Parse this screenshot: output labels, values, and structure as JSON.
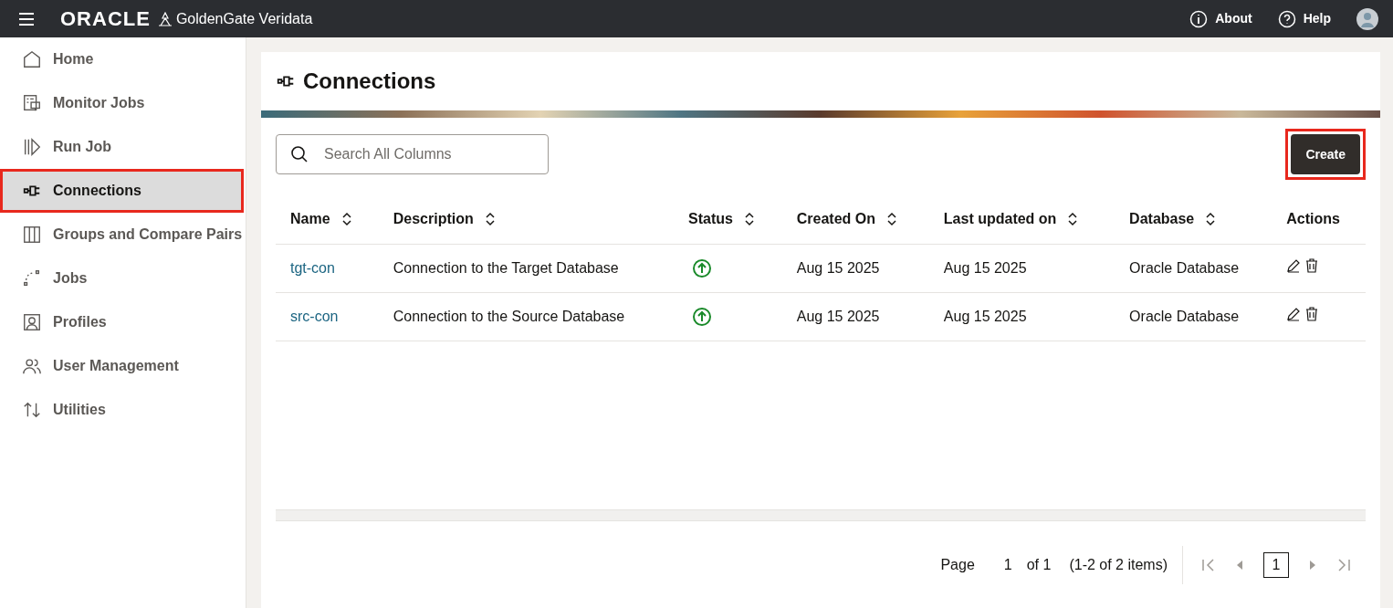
{
  "header": {
    "logo": "ORACLE",
    "product": "GoldenGate Veridata",
    "links": [
      {
        "kind": "about",
        "label": "About"
      },
      {
        "kind": "help",
        "label": "Help"
      }
    ]
  },
  "sidebar": {
    "items": [
      {
        "kind": "home",
        "label": "Home",
        "selected": false,
        "highlighted": false
      },
      {
        "kind": "monitor",
        "label": "Monitor Jobs",
        "selected": false,
        "highlighted": false
      },
      {
        "kind": "run",
        "label": "Run Job",
        "selected": false,
        "highlighted": false
      },
      {
        "kind": "plug",
        "label": "Connections",
        "selected": true,
        "highlighted": true
      },
      {
        "kind": "columns",
        "label": "Groups and Compare Pairs",
        "selected": false,
        "highlighted": false
      },
      {
        "kind": "jobs",
        "label": "Jobs",
        "selected": false,
        "highlighted": false
      },
      {
        "kind": "profile",
        "label": "Profiles",
        "selected": false,
        "highlighted": false
      },
      {
        "kind": "users",
        "label": "User Management",
        "selected": false,
        "highlighted": false
      },
      {
        "kind": "utilities",
        "label": "Utilities",
        "selected": false,
        "highlighted": false
      }
    ]
  },
  "page": {
    "title": "Connections",
    "search": {
      "placeholder": "Search All Columns"
    },
    "create_button": {
      "label": "Create",
      "highlighted": true
    }
  },
  "table": {
    "columns": [
      {
        "label": "Name",
        "sortable": true
      },
      {
        "label": "Description",
        "sortable": true
      },
      {
        "label": "Status",
        "sortable": true
      },
      {
        "label": "Created On",
        "sortable": true
      },
      {
        "label": "Last updated on",
        "sortable": true
      },
      {
        "label": "Database",
        "sortable": true
      },
      {
        "label": "Actions",
        "sortable": false
      }
    ],
    "rows": [
      {
        "name": "tgt-con",
        "description": "Connection to the Target Database",
        "online": true,
        "created": "Aug 15 2025",
        "updated": "Aug 15 2025",
        "database": "Oracle Database"
      },
      {
        "name": "src-con",
        "description": "Connection to the Source Database",
        "online": true,
        "created": "Aug 15 2025",
        "updated": "Aug 15 2025",
        "database": "Oracle Database"
      }
    ]
  },
  "pagination": {
    "page_label": "Page",
    "page_value": "1",
    "of_label": "of 1",
    "summary": "(1-2 of 2 items)",
    "current_page": "1"
  }
}
